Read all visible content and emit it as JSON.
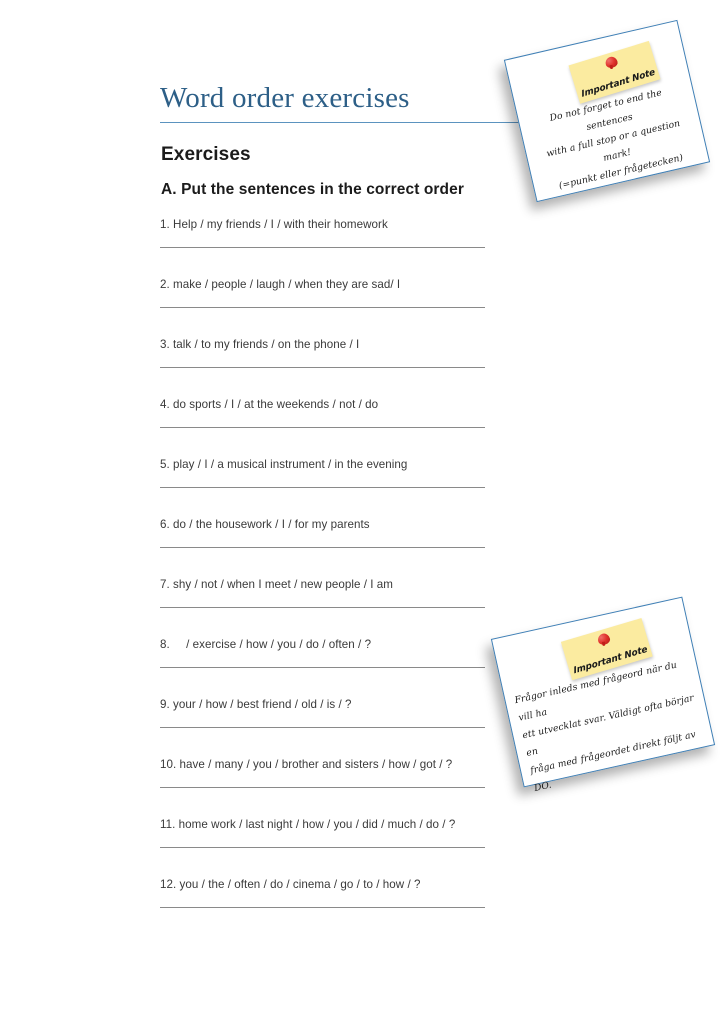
{
  "document": {
    "title": "Word order exercises",
    "heading": "Exercises",
    "section_heading": "A. Put the sentences in the correct order"
  },
  "colors": {
    "title": "#2d5f87",
    "title_rule": "#5b93bf",
    "heading": "#1b1b1b",
    "body_text": "#3a3a3a",
    "answer_line": "#8a8a8a",
    "note_border": "#3f7fb5",
    "note_tag": "#fbeba0",
    "pin": "#e0332c",
    "page_background": "#ffffff"
  },
  "exercises": [
    {
      "number": "1.",
      "text": "1. Help / my friends / I / with their homework"
    },
    {
      "number": "2.",
      "text": "2. make / people / laugh / when they are sad/ I"
    },
    {
      "number": "3.",
      "text": "3. talk / to my friends / on the phone / I"
    },
    {
      "number": "4.",
      "text": "4. do sports / I / at the weekends / not / do"
    },
    {
      "number": "5.",
      "text": "5. play / I / a musical instrument / in the evening"
    },
    {
      "number": "6.",
      "text": "6. do / the housework / I / for my parents"
    },
    {
      "number": "7.",
      "text": "7. shy / not / when I meet / new people / I am"
    },
    {
      "number": "8.",
      "text": "8.     / exercise / how / you / do / often / ?"
    },
    {
      "number": "9.",
      "text": "9. your / how / best friend / old / is / ?"
    },
    {
      "number": "10.",
      "text": "10. have / many / you / brother and sisters / how / got / ?"
    },
    {
      "number": "11.",
      "text": "11. home work / last night / how / you / did / much / do / ?"
    },
    {
      "number": "12.",
      "text": "12. you / the / often / do / cinema / go / to / how / ?"
    }
  ],
  "notes": [
    {
      "tag_label": "Important Note",
      "pin_icon": "red-pin-icon",
      "lines": [
        "Do not forget to end the sentences",
        "with a full stop or a question mark!",
        "(=punkt eller frågetecken)"
      ]
    },
    {
      "tag_label": "Important Note",
      "pin_icon": "red-pin-icon",
      "lines": [
        "Frågor inleds med frågeord när du vill ha",
        "ett utvecklat svar. Väldigt ofta börjar en",
        "fråga med frågeordet direkt följt av DO."
      ]
    }
  ]
}
